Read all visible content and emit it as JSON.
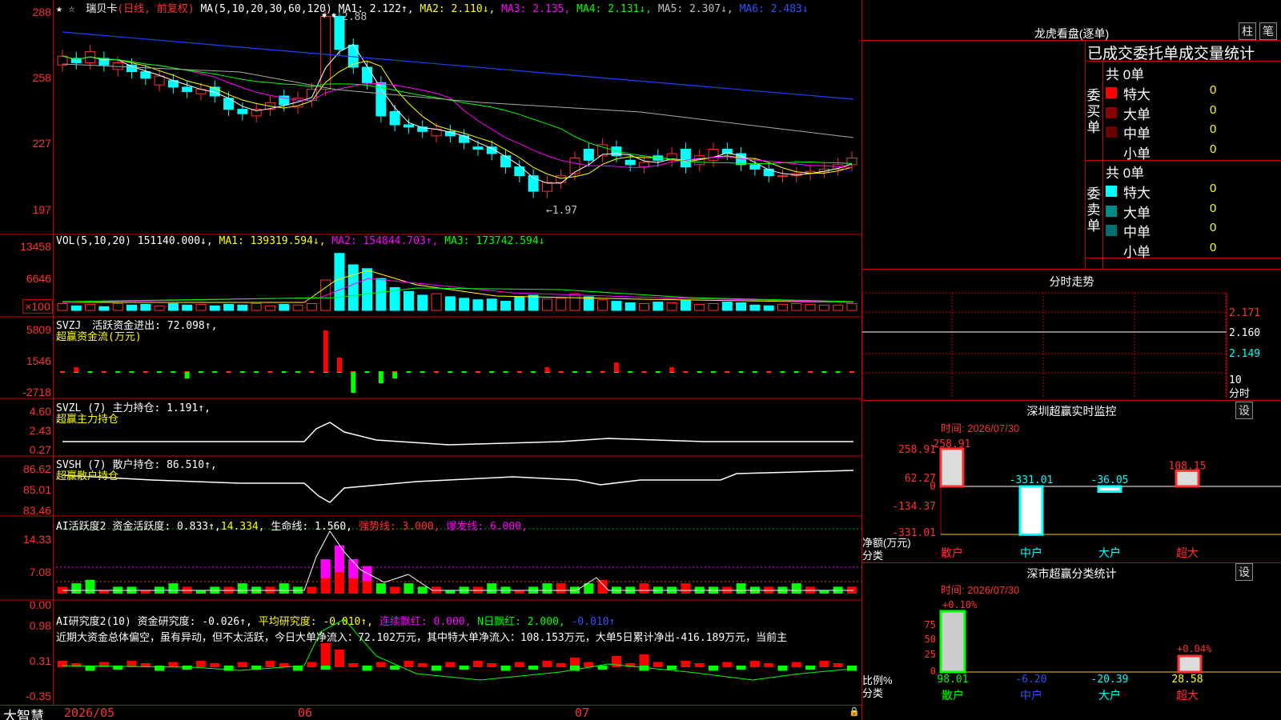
{
  "main": {
    "star": "★",
    "star_flag": "☆",
    "stock_name": "瑞贝卡",
    "period": "(日线, 前复权)",
    "ma_label": "MA(5,10,20,30,60,120)",
    "ma1": "MA1: 2.122↑,",
    "ma2": "MA2: 2.110↓,",
    "ma3": "MA3: 2.135,",
    "ma4": "MA4: 2.131↓,",
    "ma5": "MA5: 2.307↓,",
    "ma6": "MA6: 2.483↓",
    "high_mark": "2.88",
    "low_mark": "←1.97",
    "y_ticks": [
      "288",
      "258",
      "227",
      "197"
    ],
    "vol_ticks": [
      "13458",
      "6646",
      "×100"
    ],
    "svzj_ticks": [
      "5809",
      "1546",
      "-2718"
    ],
    "svzl_ticks": [
      "4.60",
      "2.43",
      "0.27"
    ],
    "svsh_ticks": [
      "86.62",
      "85.01",
      "83.46"
    ],
    "ai1_ticks": [
      "14.33",
      "7.08",
      "0.00"
    ],
    "ai2_ticks": [
      "0.98",
      "0.31",
      "-0.35"
    ]
  },
  "indicators": {
    "vol": {
      "name": "VOL(5,10,20)",
      "val": "151140.000↓,",
      "ma1": "MA1: 139319.594↓,",
      "ma2": "MA2: 154844.703↑,",
      "ma3": "MA3: 173742.594↓"
    },
    "svzj": {
      "name": "SVZJ",
      "label": "活跃资金进出: 72.098↑,",
      "sub": "超赢资金流(万元)"
    },
    "svzl": {
      "name": "SVZL (7)",
      "label": "主力持仓: 1.191↑,",
      "sub": "超赢主力持仓"
    },
    "svsh": {
      "name": "SVSH (7)",
      "label": "散户持仓: 86.510↑,",
      "sub": "超赢散户持仓"
    },
    "ai1": {
      "name": "AI活跃度2",
      "label": "资金活跃度: 0.833↑,",
      "v2": "14.334,",
      "life": "生命线: 1.560,",
      "strong": "强势线: 3.000,",
      "burst": "爆发线: 6.000,"
    },
    "ai2": {
      "name": "AI研究度2(10)",
      "label": "资金研究度: -0.026↑,",
      "avg": "平均研究度: -0.010↑,",
      "red": "连续飘红: 0.000,",
      "nred": "N日飘红: 2.000,",
      "extra": "-0.010↑",
      "summary": "近期大资金总体偏空，虽有异动，但不太活跃，今日大单净流入：72.102万元，其中特大单净流入：108.153万元，大单5日累计净出-416.189万元，当前主"
    }
  },
  "bottom": {
    "brand": "大智慧",
    "date1": "2026/05",
    "date2": "06",
    "date3": "07"
  },
  "right": {
    "dragon_title": "龙虎看盘(逐单)",
    "btn_bar": "柱",
    "btn_pen": "笔",
    "stats_title": "已成交委托单成交量统计",
    "buy_total": "共 0单",
    "sell_total": "共 0单",
    "buy_side": "委买单",
    "sell_side": "委卖单",
    "buy_rows": [
      {
        "label": "特大",
        "val": "0",
        "color": "#ff0000"
      },
      {
        "label": "大单",
        "val": "0",
        "color": "#8b0000"
      },
      {
        "label": "中单",
        "val": "0",
        "color": "#6b0000"
      },
      {
        "label": "小单",
        "val": "0",
        "color": "#000"
      }
    ],
    "sell_rows": [
      {
        "label": "特大",
        "val": "0",
        "color": "#00ffff"
      },
      {
        "label": "大单",
        "val": "0",
        "color": "#008b8b"
      },
      {
        "label": "中单",
        "val": "0",
        "color": "#007070"
      },
      {
        "label": "小单",
        "val": "0",
        "color": "#000"
      }
    ],
    "intraday_title": "分时走势",
    "intraday_ticks": [
      "2.171",
      "2.160",
      "2.149",
      "10",
      "分时"
    ],
    "sz_title": "深圳超赢实时监控",
    "sz_btn": "设",
    "sz_time": "时间: 2026/07/30",
    "sz_ticks": [
      "258.91",
      "62.27",
      "0",
      "-134.37",
      "-331.01"
    ],
    "sz_values": [
      "258.91",
      "-331.01",
      "-36.05",
      "108.15"
    ],
    "sz_ylabel": "净额(万元)",
    "sz_xlabel": "分类",
    "cats": [
      "散户",
      "中户",
      "大户",
      "超大"
    ],
    "sc_title": "深市超赢分类统计",
    "sc_btn": "设",
    "sc_time": "时间: 2026/07/30",
    "sc_top": [
      "+0.10%",
      "+0.04%"
    ],
    "sc_ticks": [
      "75",
      "50",
      "25",
      "0"
    ],
    "sc_values": [
      "98.01",
      "-6.20",
      "-20.39",
      "28.58"
    ],
    "sc_ylabel": "比例%",
    "sc_xlabel": "分类"
  },
  "chart_data": {
    "type": "candlestick",
    "title": "瑞贝卡 (日线, 前复权)",
    "x_labels": [
      "2026/05",
      "06",
      "07"
    ],
    "ylim": [
      1.97,
      2.88
    ],
    "y_ticks": [
      2.88,
      2.58,
      2.27,
      1.97
    ],
    "high": 2.88,
    "low": 1.97,
    "series": [
      {
        "name": "MA1",
        "value": 2.122
      },
      {
        "name": "MA2",
        "value": 2.11
      },
      {
        "name": "MA3",
        "value": 2.135
      },
      {
        "name": "MA4",
        "value": 2.131
      },
      {
        "name": "MA5",
        "value": 2.307
      },
      {
        "name": "MA6",
        "value": 2.483
      }
    ]
  }
}
